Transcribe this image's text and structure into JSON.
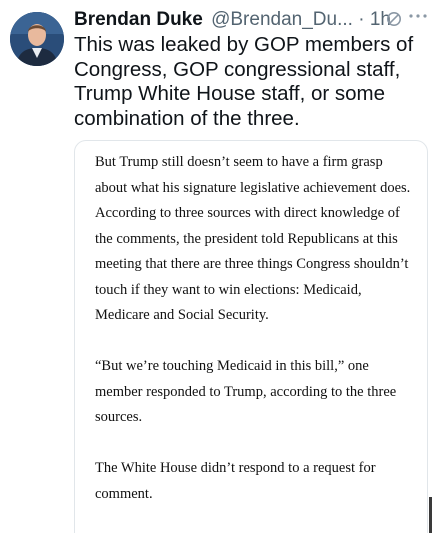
{
  "tweet": {
    "author_name": "Brendan Duke",
    "handle": "@Brendan_Du...",
    "separator": "·",
    "time": "1h",
    "status_icon": "no-sign-icon",
    "more_icon": "more-dots-icon",
    "text": "This was leaked by GOP members of Congress, GOP congressional staff, Trump White House staff, or some combination of the three."
  },
  "quote": {
    "paragraphs": [
      "But Trump still doesn’t seem to have a firm grasp about what his signature legislative achievement does. According to three sources with direct knowledge of the comments, the president told Republicans at this meeting that there are three things Congress shouldn’t touch if they want to win elections: Medicaid, Medicare and Social Security.",
      "“But we’re touching Medicaid in this bill,” one member responded to Trump, according to the three sources.",
      "The White House didn’t respond to a request for comment."
    ]
  },
  "colors": {
    "text_primary": "#0f1419",
    "text_secondary": "#536471",
    "card_border": "#e1e6ea",
    "avatar_bg": "#2a4d79"
  }
}
